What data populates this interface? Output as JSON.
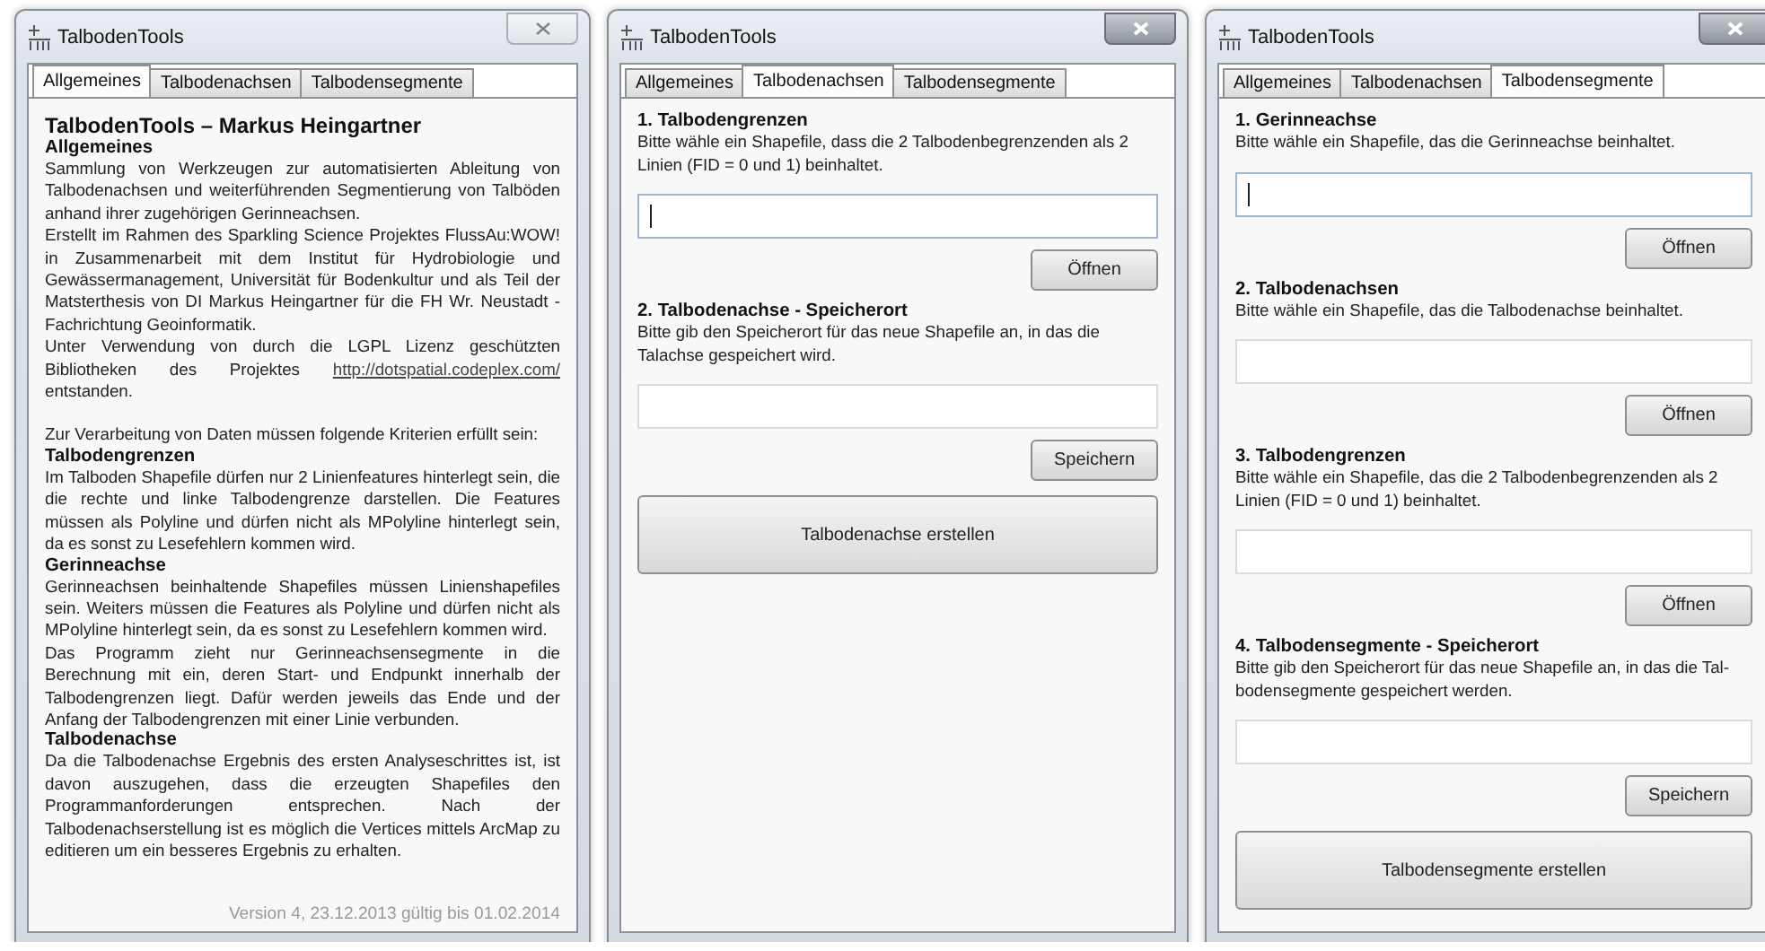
{
  "windows": [
    {
      "title": "TalbodenTools",
      "active": false,
      "tabs": [
        {
          "label": "Allgemeines",
          "selected": true
        },
        {
          "label": "Talbodenachsen",
          "selected": false
        },
        {
          "label": "Talbodensegmente",
          "selected": false
        }
      ],
      "content": {
        "kind": "about",
        "blocks": [
          {
            "kind": "title",
            "text": "TalbodenTools – Markus Heingartner"
          },
          {
            "kind": "heading",
            "text": "Allgemeines"
          },
          {
            "kind": "para",
            "text": "Sammlung von Werkzeugen zur automatisierten Ableitung von Talbodenachsen und weiterführenden Segmentierung von Talböden anhand ihrer zugehörigen Gerinneachsen."
          },
          {
            "kind": "para",
            "text": "Erstellt im Rahmen des Sparkling Science Projektes FlussAu:WOW! in Zusammenarbeit mit dem Institut für Hydrobiologie und Gewässermanagement, Universität für Bodenkultur und als Teil der Matsterthesis von DI Markus Heingartner für die FH Wr. Neustadt - Fachrichtung Geoinformatik."
          },
          {
            "kind": "para",
            "text": "Unter Verwendung von durch die LGPL Lizenz geschützten Bibliotheken des Projektes",
            "link": "http://dotspatial.codeplex.com/",
            "after": "entstanden."
          },
          {
            "kind": "para",
            "gap_before": true,
            "text": "Zur Verarbeitung von Daten müssen folgende Kriterien erfüllt sein:"
          },
          {
            "kind": "heading",
            "text": "Talbodengrenzen"
          },
          {
            "kind": "para",
            "text": "Im Talboden Shapefile dürfen nur 2 Linienfeatures hinterlegt sein, die die rechte und linke Talbodengrenze darstellen. Die Features müssen als Polyline und dürfen nicht als MPolyline hinterlegt sein, da es sonst zu Lesefehlern kommen wird."
          },
          {
            "kind": "heading",
            "text": "Gerinneachse"
          },
          {
            "kind": "para",
            "text": "Gerinneachsen beinhaltende Shapefiles müssen Linienshapefiles sein. Weiters müssen die Features als Polyline und dürfen nicht als MPolyline hinterlegt sein, da es sonst zu Lesefehlern kommen wird."
          },
          {
            "kind": "para",
            "text": "Das Programm zieht nur Gerinneachsensegmente in die Berechnung mit ein, deren Start- und Endpunkt innerhalb der Talbodengrenzen liegt. Dafür werden jeweils das Ende und der Anfang der Talbodengrenzen mit einer Linie verbunden."
          },
          {
            "kind": "heading",
            "text": "Talbodenachse"
          },
          {
            "kind": "para",
            "text": "Da die Talbodenachse Ergebnis des ersten Analyseschrittes ist, ist davon auszugehen, dass die erzeugten Shapefiles den Programmanforderungen entsprechen. Nach der Talbodenachserstellung ist es möglich die Vertices mittels ArcMap zu editieren um ein besseres Ergebnis zu erhalten."
          }
        ],
        "footer": "Version 4, 23.12.2013 gültig bis 01.02.2014"
      }
    },
    {
      "title": "TalbodenTools",
      "active": true,
      "tabs": [
        {
          "label": "Allgemeines",
          "selected": false
        },
        {
          "label": "Talbodenachsen",
          "selected": true
        },
        {
          "label": "Talbodensegmente",
          "selected": false
        }
      ],
      "content": {
        "kind": "form",
        "sections": [
          {
            "heading": "1. Talbodengrenzen",
            "description": "Bitte wähle ein Shapefile, dass die 2 Talbodenbegrenzenden als 2 Linien (FID = 0 und 1) beinhaltet.",
            "focused": true,
            "button": "Öffnen"
          },
          {
            "heading": "2. Talbodenachse - Speicherort",
            "description": "Bitte gib den Speicherort für das neue Shapefile an, in das die Talachse gespeichert wird.",
            "focused": false,
            "button": "Speichern"
          }
        ],
        "action": "Talbodenachse erstellen"
      }
    },
    {
      "title": "TalbodenTools",
      "active": true,
      "tabs": [
        {
          "label": "Allgemeines",
          "selected": false
        },
        {
          "label": "Talbodenachsen",
          "selected": false
        },
        {
          "label": "Talbodensegmente",
          "selected": true
        }
      ],
      "content": {
        "kind": "form",
        "sections": [
          {
            "heading": "1. Gerinneachse",
            "description": "Bitte wähle ein Shapefile, das die Gerinneachse beinhaltet.",
            "focused": true,
            "button": "Öffnen"
          },
          {
            "heading": "2. Talbodenachsen",
            "description": "Bitte wähle ein Shapefile, das die Talbodenachse beinhaltet.",
            "focused": false,
            "button": "Öffnen"
          },
          {
            "heading": "3. Talbodengrenzen",
            "description": "Bitte wähle ein Shapefile, das die 2 Talbodenbegrenzenden als 2 Linien (FID = 0 und 1) beinhaltet.",
            "focused": false,
            "button": "Öffnen"
          },
          {
            "heading": "4. Talbodensegmente - Speicherort",
            "description": "Bitte gib den Speicherort für das neue Shapefile an, in das die Tal-bodensegmente gespeichert werden.",
            "focused": false,
            "button": "Speichern"
          }
        ],
        "action": "Talbodensegmente erstellen"
      }
    }
  ]
}
